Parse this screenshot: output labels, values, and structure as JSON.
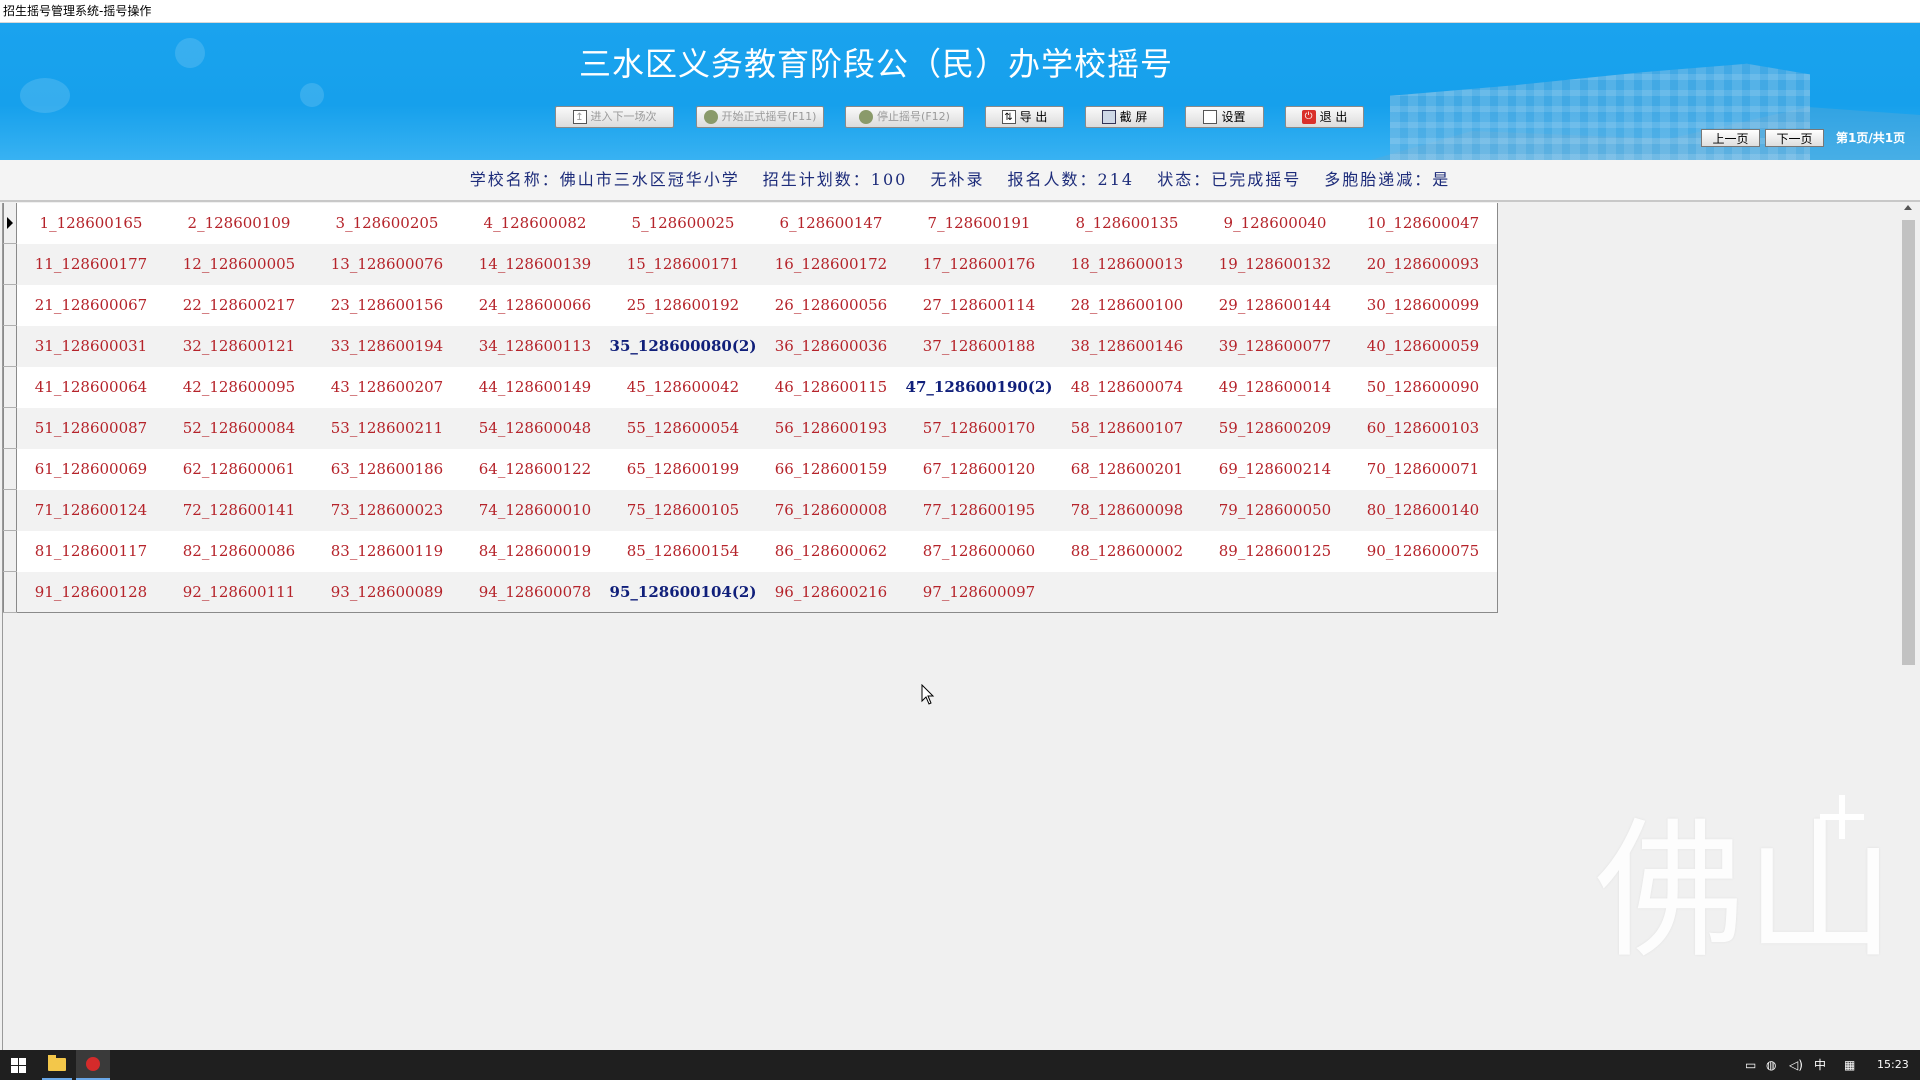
{
  "window": {
    "title": "招生摇号管理系统-摇号操作"
  },
  "header": {
    "title": "三水区义务教育阶段公（民）办学校摇号",
    "buttons": [
      {
        "label": "进入下一场次",
        "icon": "next-round-icon",
        "enabled": false
      },
      {
        "label": "开始正式摇号(F11)",
        "icon": "users-icon",
        "enabled": false
      },
      {
        "label": "停止摇号(F12)",
        "icon": "user-stop-icon",
        "enabled": false
      },
      {
        "label": "导 出",
        "icon": "export-icon",
        "enabled": true
      },
      {
        "label": "截 屏",
        "icon": "screenshot-icon",
        "enabled": true
      },
      {
        "label": "设置",
        "icon": "settings-doc-icon",
        "enabled": true
      },
      {
        "label": "退 出",
        "icon": "exit-icon",
        "enabled": true
      }
    ],
    "pager": {
      "prev": "上一页",
      "next": "下一页",
      "info": "第1页/共1页"
    }
  },
  "info": {
    "school": "学校名称：佛山市三水区冠华小学",
    "plan": "招生计划数：100",
    "supplement": "无补录",
    "applicants": "报名人数：214",
    "status": "状态：已完成摇号",
    "multiple_birth": "多胞胎递减：是"
  },
  "grid": {
    "rows": [
      [
        "1_128600165",
        "2_128600109",
        "3_128600205",
        "4_128600082",
        "5_128600025",
        "6_128600147",
        "7_128600191",
        "8_128600135",
        "9_128600040",
        "10_128600047"
      ],
      [
        "11_128600177",
        "12_128600005",
        "13_128600076",
        "14_128600139",
        "15_128600171",
        "16_128600172",
        "17_128600176",
        "18_128600013",
        "19_128600132",
        "20_128600093"
      ],
      [
        "21_128600067",
        "22_128600217",
        "23_128600156",
        "24_128600066",
        "25_128600192",
        "26_128600056",
        "27_128600114",
        "28_128600100",
        "29_128600144",
        "30_128600099"
      ],
      [
        "31_128600031",
        "32_128600121",
        "33_128600194",
        "34_128600113",
        "35_128600080(2)",
        "36_128600036",
        "37_128600188",
        "38_128600146",
        "39_128600077",
        "40_128600059"
      ],
      [
        "41_128600064",
        "42_128600095",
        "43_128600207",
        "44_128600149",
        "45_128600042",
        "46_128600115",
        "47_128600190(2)",
        "48_128600074",
        "49_128600014",
        "50_128600090"
      ],
      [
        "51_128600087",
        "52_128600084",
        "53_128600211",
        "54_128600048",
        "55_128600054",
        "56_128600193",
        "57_128600170",
        "58_128600107",
        "59_128600209",
        "60_128600103"
      ],
      [
        "61_128600069",
        "62_128600061",
        "63_128600186",
        "64_128600122",
        "65_128600199",
        "66_128600159",
        "67_128600120",
        "68_128600201",
        "69_128600214",
        "70_128600071"
      ],
      [
        "71_128600124",
        "72_128600141",
        "73_128600023",
        "74_128600010",
        "75_128600105",
        "76_128600008",
        "77_128600195",
        "78_128600098",
        "79_128600050",
        "80_128600140"
      ],
      [
        "81_128600117",
        "82_128600086",
        "83_128600119",
        "84_128600019",
        "85_128600154",
        "86_128600062",
        "87_128600060",
        "88_128600002",
        "89_128600125",
        "90_128600075"
      ],
      [
        "91_128600128",
        "92_128600111",
        "93_128600089",
        "94_128600078",
        "95_128600104(2)",
        "96_128600216",
        "97_128600097",
        "",
        "",
        ""
      ]
    ],
    "highlighted": [
      "35_128600080(2)",
      "47_128600190(2)",
      "95_128600104(2)"
    ],
    "colors": {
      "normal": "#b5232a",
      "highlight": "#101f7a"
    }
  },
  "watermark": {
    "text": "佛山"
  },
  "taskbar": {
    "apps": [
      "windows-start-icon",
      "file-explorer-icon",
      "app-icon"
    ],
    "tray": {
      "ime": "中",
      "time": "15:23"
    }
  }
}
